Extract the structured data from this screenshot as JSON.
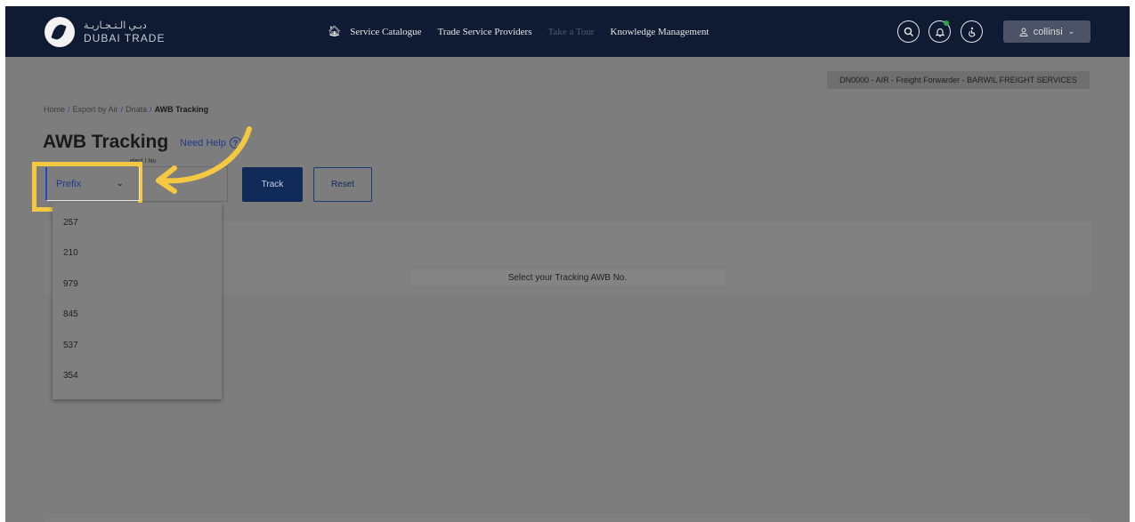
{
  "brand": {
    "arabic": "دبـي الـتـجـاريـة",
    "english": "DUBAI TRADE"
  },
  "nav": {
    "links": [
      {
        "label": "Service Catalogue",
        "dim": false
      },
      {
        "label": "Trade Service Providers",
        "dim": false
      },
      {
        "label": "Take a Tour",
        "dim": true
      },
      {
        "label": "Knowledge Management",
        "dim": false
      }
    ],
    "user_label": "collinsi",
    "icons": [
      "search-icon",
      "bell-icon",
      "accessibility-icon",
      "user-icon",
      "chevron-down-icon"
    ]
  },
  "company_badge": "DN0000 - AIR - Freight Forwarder - BARWIL FREIGHT SERVICES",
  "breadcrumb": {
    "items": [
      "Home",
      "Export by Air",
      "Dnata",
      "AWB Tracking"
    ],
    "separator": "/"
  },
  "page": {
    "title": "AWB Tracking",
    "help_label": "Need Help",
    "field_label": "Select AWB No.",
    "field_label_partial": "elect  l No."
  },
  "prefix_select": {
    "value": "Prefix"
  },
  "buttons": {
    "track": "Track",
    "reset": "Reset"
  },
  "prefix_options": [
    "257",
    "210",
    "979",
    "845",
    "537",
    "354"
  ],
  "result_message": "Select your Tracking AWB No.",
  "colors": {
    "nav_bg": "#0f1a33",
    "highlight": "#f5c842",
    "primary": "#102b5a"
  }
}
